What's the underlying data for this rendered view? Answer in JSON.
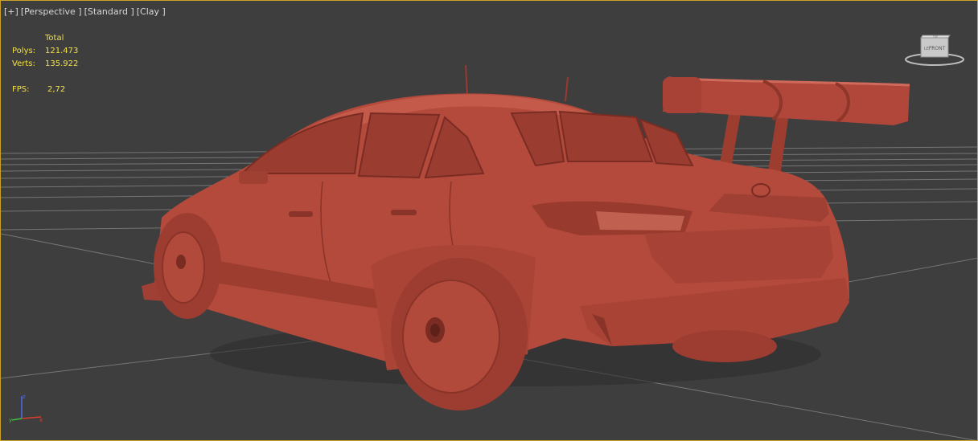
{
  "viewport": {
    "label_plus": "[+]",
    "label_view": "[Perspective ]",
    "label_shading": "[Standard ]",
    "label_style": "[Clay ]"
  },
  "stats": {
    "total_label": "Total",
    "polys_label": "Polys:",
    "polys_value": "121.473",
    "verts_label": "Verts:",
    "verts_value": "135.922",
    "fps_label": "FPS:",
    "fps_value": "2,72"
  },
  "viewcube": {
    "face_top": "TOP",
    "face_front": "FRONT",
    "face_left": "LEFT"
  },
  "gizmo": {
    "x": "x",
    "y": "y",
    "z": "z"
  },
  "colors": {
    "background": "#3e3e3e",
    "border_active": "#c9a227",
    "stats_text": "#f2e04a",
    "clay": "#b44a3b",
    "grid": "#8a8a8a",
    "axis_x": "#e03a2f",
    "axis_y": "#40c040",
    "axis_z": "#4a6cf0"
  },
  "icons": [
    "viewcube-icon",
    "axis-gizmo-icon"
  ]
}
